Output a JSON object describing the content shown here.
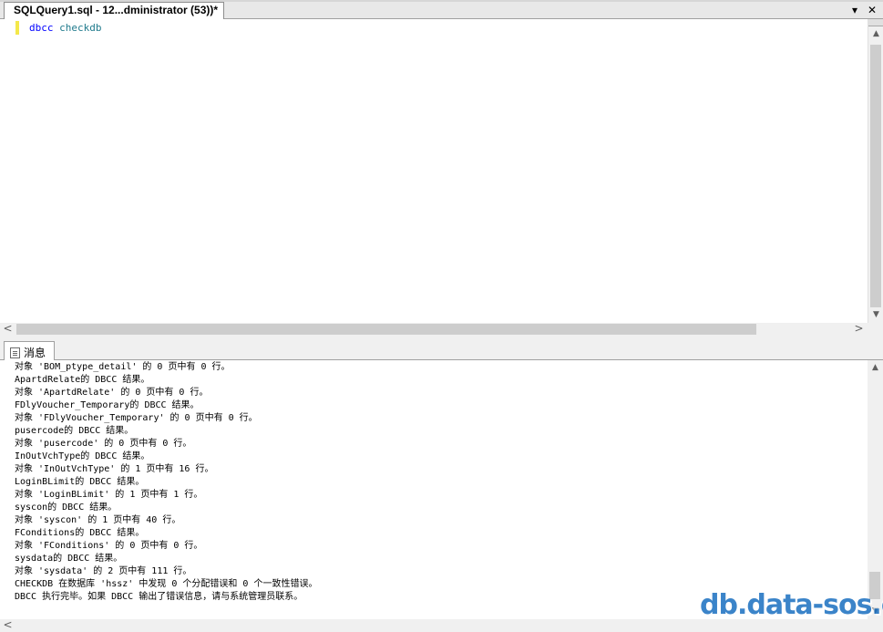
{
  "document_tab": {
    "title": "SQLQuery1.sql - 12...dministrator (53))*"
  },
  "tab_strip": {
    "dropdown_glyph": "▾",
    "close_glyph": "✕"
  },
  "editor": {
    "line1_keyword1": "dbcc",
    "line1_keyword2": "checkdb"
  },
  "scroll_glyphs": {
    "up": "▲",
    "down": "▼",
    "left": "<",
    "right": ">"
  },
  "results_tab": {
    "label": "消息"
  },
  "messages": [
    "对象 'BOM_ptype_detail' 的 0 页中有 0 行。",
    "ApartdRelate的 DBCC 结果。",
    "对象 'ApartdRelate' 的 0 页中有 0 行。",
    "FDlyVoucher_Temporary的 DBCC 结果。",
    "对象 'FDlyVoucher_Temporary' 的 0 页中有 0 行。",
    "pusercode的 DBCC 结果。",
    "对象 'pusercode' 的 0 页中有 0 行。",
    "InOutVchType的 DBCC 结果。",
    "对象 'InOutVchType' 的 1 页中有 16 行。",
    "LoginBLimit的 DBCC 结果。",
    "对象 'LoginBLimit' 的 1 页中有 1 行。",
    "syscon的 DBCC 结果。",
    "对象 'syscon' 的 1 页中有 40 行。",
    "FConditions的 DBCC 结果。",
    "对象 'FConditions' 的 0 页中有 0 行。",
    "sysdata的 DBCC 结果。",
    "对象 'sysdata' 的 2 页中有 111 行。",
    "CHECKDB 在数据库 'hssz' 中发现 0 个分配错误和 0 个一致性错误。",
    "DBCC 执行完毕。如果 DBCC 输出了错误信息，请与系统管理员联系。"
  ],
  "watermark": {
    "text": "db.data-sos.cn"
  }
}
